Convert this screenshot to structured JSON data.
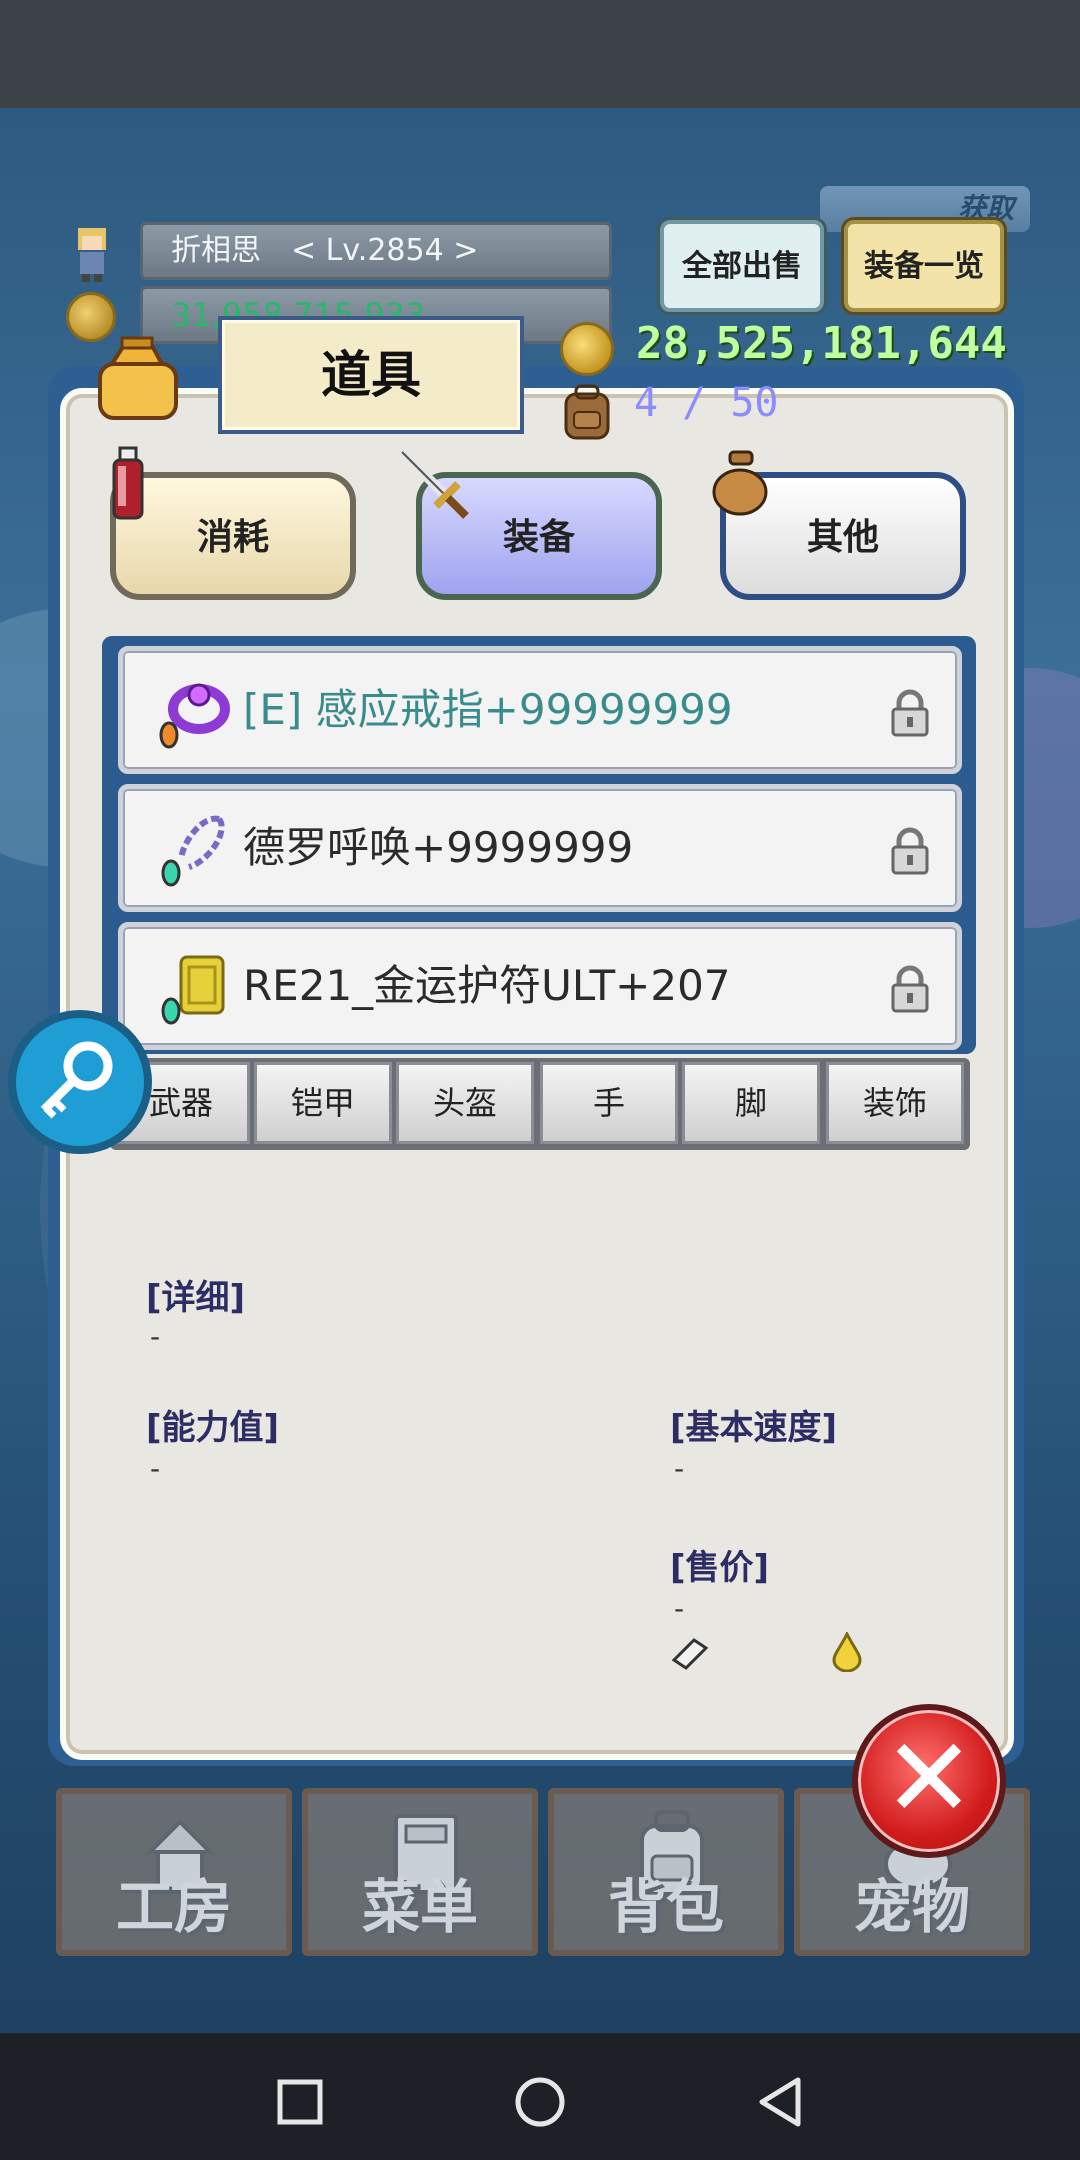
{
  "player": {
    "name_level": "折相思　< Lv.2854 >",
    "money_partial": "31,958,715,933"
  },
  "header": {
    "title": "道具",
    "gold": "28,525,181,644",
    "capacity": "4 / 50",
    "obtain_tag": "获取"
  },
  "top_buttons": {
    "sell_all": "全部出售",
    "equip_list": "装备一览"
  },
  "categories": [
    {
      "label": "消耗"
    },
    {
      "label": "装备"
    },
    {
      "label": "其他"
    }
  ],
  "items": [
    {
      "name": "[E] 感应戒指+99999999",
      "equipped": true,
      "icon": "ring-icon"
    },
    {
      "name": "德罗呼唤+9999999",
      "equipped": false,
      "icon": "necklace-icon"
    },
    {
      "name": "RE21_金运护符ULT+207",
      "equipped": false,
      "icon": "amulet-icon"
    }
  ],
  "filters": [
    "武器",
    "铠甲",
    "头盔",
    "手",
    "脚",
    "装饰"
  ],
  "details": {
    "detail_label": "[详细]",
    "detail_value": "-",
    "stats_label": "[能力值]",
    "stats_value": "-",
    "speed_label": "[基本速度]",
    "speed_value": "-",
    "price_label": "[售价]",
    "price_value": "-"
  },
  "bottom_menu": [
    {
      "label": "工房",
      "icon": "workshop-icon"
    },
    {
      "label": "菜单",
      "icon": "book-icon"
    },
    {
      "label": "背包",
      "icon": "backpack-icon"
    },
    {
      "label": "宠物",
      "icon": "pet-icon"
    }
  ],
  "colors": {
    "gold_text": "#bfff9e",
    "capacity_text": "#8b8cff",
    "equipped_item": "#3a8b8b",
    "panel_border": "#2d5f92"
  }
}
